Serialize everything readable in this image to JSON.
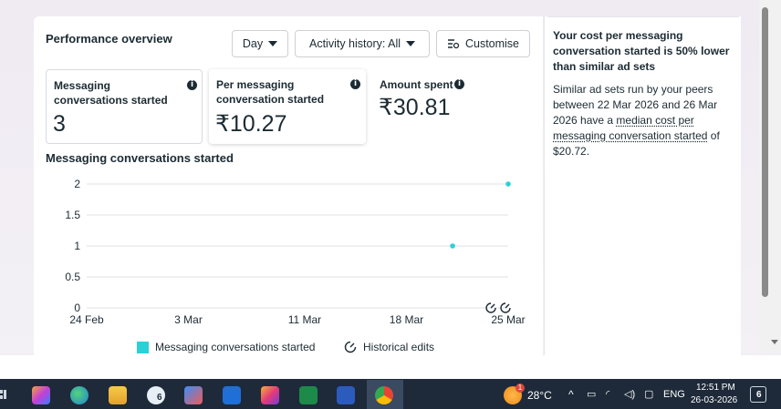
{
  "header": {
    "title": "Performance overview",
    "day_dropdown": "Day",
    "activity_dropdown": "Activity history: All",
    "customise_button": "Customise"
  },
  "metrics": [
    {
      "label": "Messaging conversations started",
      "value": "3"
    },
    {
      "label": "Per messaging conversation started",
      "value": "₹10.27"
    },
    {
      "label": "Amount spent",
      "value": "₹30.81"
    }
  ],
  "chart_title": "Messaging conversations started",
  "chart_data": {
    "type": "scatter",
    "title": "Messaging conversations started",
    "xlabel": "",
    "ylabel": "",
    "x_tick_labels": [
      "24 Feb",
      "3 Mar",
      "11 Mar",
      "18 Mar",
      "25 Mar"
    ],
    "y_tick_labels": [
      "0",
      "0.5",
      "1",
      "1.5",
      "2"
    ],
    "ylim": [
      0,
      2
    ],
    "grid": true,
    "series": [
      {
        "name": "Messaging conversations started",
        "color": "#2ad1d6",
        "x": [
          "24 Mar",
          "25 Mar"
        ],
        "values": [
          1,
          2
        ]
      }
    ],
    "historical_edit_markers_x": [
      "24 Mar",
      "25 Mar"
    ],
    "legend": [
      "Messaging conversations started",
      "Historical edits"
    ],
    "legend_position": "bottom"
  },
  "side_panel": {
    "heading": "Your cost per messaging conversation started is 50% lower than similar ad sets",
    "body_pre": "Similar ad sets run by your peers between 22 Mar 2026 and 26 Mar 2026 have a ",
    "body_link": "median cost per messaging conversation started",
    "body_post": " of $20.72."
  },
  "taskbar": {
    "weather_temp": "28°C",
    "weather_badge": "1",
    "language": "ENG",
    "time": "12:51 PM",
    "date": "26-03-2026",
    "notification_count": "6",
    "chrome_badge": "6",
    "icons": [
      "task-view-icon",
      "copilot-icon",
      "edge-icon",
      "file-explorer-icon",
      "chrome-profile-icon",
      "store-icon",
      "outlook-icon",
      "instagram-icon",
      "excel-icon",
      "word-icon",
      "chrome-icon"
    ]
  },
  "colors": {
    "accent": "#2ad1d6",
    "taskbar": "#1e2a3a"
  }
}
